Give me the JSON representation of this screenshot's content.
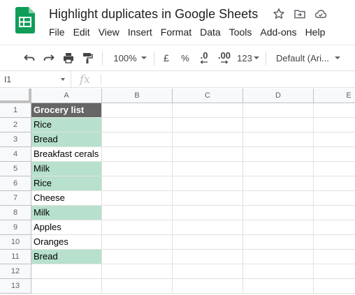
{
  "app": {
    "doc_title": "Highlight duplicates in Google Sheets",
    "logo_icon": "google-sheets-icon",
    "title_icons": [
      "star-icon",
      "move-to-folder-icon",
      "cloud-status-icon"
    ],
    "brand_color": "#0f9d58"
  },
  "menu": [
    "File",
    "Edit",
    "View",
    "Insert",
    "Format",
    "Data",
    "Tools",
    "Add-ons",
    "Help"
  ],
  "toolbar": {
    "undo_icon": "undo-icon",
    "redo_icon": "redo-icon",
    "print_icon": "print-icon",
    "paint_format_icon": "paint-format-icon",
    "zoom": "100%",
    "currency": "£",
    "percent": "%",
    "decrease_decimal": ".0",
    "increase_decimal": ".00",
    "more_formats": "123",
    "font": "Default (Ari..."
  },
  "formula_bar": {
    "cell_ref": "I1",
    "fx_label": "fx",
    "value": ""
  },
  "sheet": {
    "columns": [
      "A",
      "B",
      "C",
      "D",
      "E"
    ],
    "rows": [
      "1",
      "2",
      "3",
      "4",
      "5",
      "6",
      "7",
      "8",
      "9",
      "10",
      "11",
      "12",
      "13"
    ],
    "column_a": [
      {
        "text": "Grocery list",
        "style": "header"
      },
      {
        "text": "Rice",
        "style": "duplicate"
      },
      {
        "text": "Bread",
        "style": "duplicate"
      },
      {
        "text": "Breakfast cerals",
        "style": "plain"
      },
      {
        "text": "Milk",
        "style": "duplicate"
      },
      {
        "text": "Rice",
        "style": "duplicate"
      },
      {
        "text": "Cheese",
        "style": "plain"
      },
      {
        "text": "Milk",
        "style": "duplicate"
      },
      {
        "text": "Apples",
        "style": "plain"
      },
      {
        "text": "Oranges",
        "style": "plain"
      },
      {
        "text": "Bread",
        "style": "duplicate"
      },
      {
        "text": "",
        "style": "plain"
      },
      {
        "text": "",
        "style": "plain"
      }
    ],
    "colors": {
      "duplicate_fill": "#b7e1cd",
      "header_fill": "#666666",
      "header_text": "#ffffff"
    }
  }
}
